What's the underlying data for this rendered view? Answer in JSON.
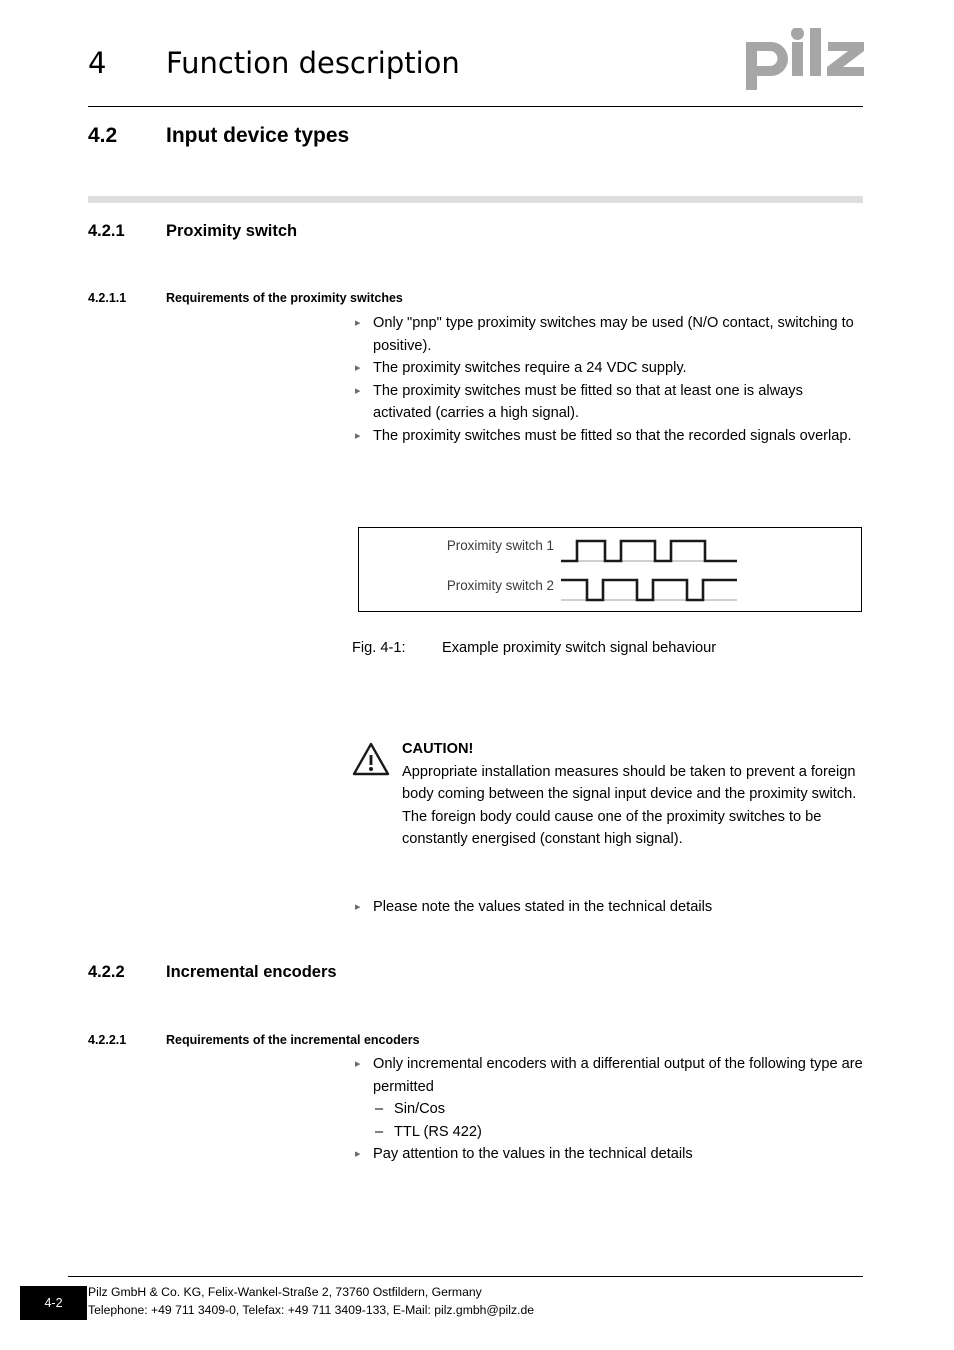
{
  "header": {
    "chapter_number": "4",
    "chapter_title": "Function description",
    "logo_text": "pilz"
  },
  "section": {
    "number": "4.2",
    "title": "Input device types"
  },
  "subsection_421": {
    "number": "4.2.1",
    "title": "Proximity switch"
  },
  "subsection_4211": {
    "number": "4.2.1.1",
    "title": "Requirements of the proximity switches",
    "bullets": [
      "Only \"pnp\" type proximity switches may be used (N/O contact, switching to positive).",
      "The proximity switches require a 24 VDC supply.",
      "The proximity switches must be fitted so that at least one is always activated (carries a high signal).",
      "The proximity switches must be fitted so that the recorded signals overlap."
    ]
  },
  "figure": {
    "label_1": "Proximity switch 1",
    "label_2": "Proximity switch 2",
    "caption_number": "Fig. 4-1:",
    "caption_text": "Example proximity switch signal behaviour"
  },
  "caution": {
    "icon": "warning-triangle-icon",
    "title": "CAUTION!",
    "text": "Appropriate installation measures should be taken to prevent a foreign body coming between the signal input device and the proximity switch. The foreign body could cause one of the proximity switches to be constantly energised (constant high signal)."
  },
  "note_bullet": "Please note the values stated in the technical details",
  "subsection_422": {
    "number": "4.2.2",
    "title": "Incremental encoders"
  },
  "subsection_4221": {
    "number": "4.2.2.1",
    "title": "Requirements of the incremental encoders",
    "bullet_1": "Only incremental encoders with a differential output of the following type are permitted",
    "subitems": [
      "Sin/Cos",
      "TTL (RS 422)"
    ],
    "bullet_2": "Pay attention to the values in the technical details"
  },
  "footer": {
    "page_number": "4-2",
    "line_1": "Pilz GmbH & Co. KG, Felix-Wankel-Straße 2, 73760 Ostfildern, Germany",
    "line_2": "Telephone: +49 711 3409-0, Telefax: +49 711 3409-133, E-Mail: pilz.gmbh@pilz.de"
  },
  "colors": {
    "gray_bar": "#dededf",
    "logo_gray": "#a6a6a6",
    "bullet_marker": "#6b6b6b"
  }
}
